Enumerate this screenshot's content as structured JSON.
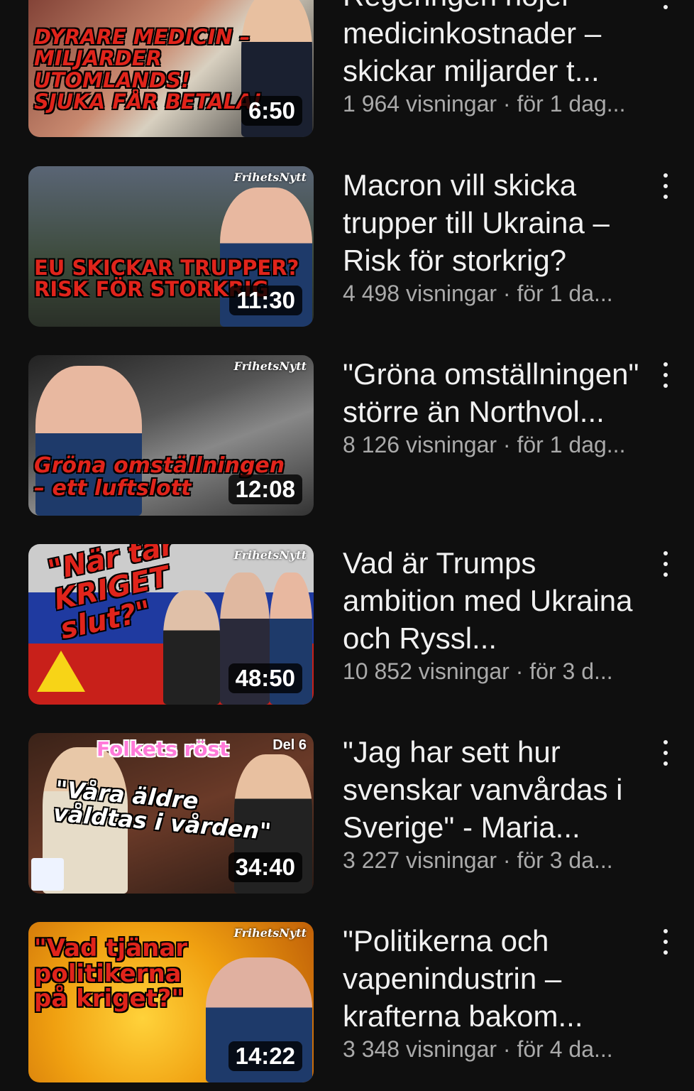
{
  "videos": [
    {
      "title": "Regeringen höjer medicinkostnader – skickar miljarder t...",
      "views": "1 964 visningar",
      "age": "för 1 dag...",
      "duration": "6:50",
      "thumb_caption": "DYRARE MEDICIN –\nMILJARDER\nUTOMLANDS!\nSJUKA FÅR BETALA!",
      "brand": "",
      "colors": {
        "bg": "#5a2a2a",
        "caption": "#e0241b"
      }
    },
    {
      "title": "Macron vill skicka trupper till Ukraina – Risk för storkrig?",
      "views": "4 498 visningar",
      "age": "för 1 da...",
      "duration": "11:30",
      "thumb_caption": "EU SKICKAR TRUPPER?\nRISK FÖR STORKRIG",
      "brand": "FrihetsNytt",
      "colors": {
        "bg": "#4a5566",
        "caption": "#e0241b"
      }
    },
    {
      "title": "\"Gröna omställningen\" större än Northvol...",
      "views": "8 126 visningar",
      "age": "för 1 dag...",
      "duration": "12:08",
      "thumb_caption": "Gröna omställningen\n– ett luftslott",
      "brand": "FrihetsNytt",
      "colors": {
        "bg": "#3a3f48",
        "caption": "#e0241b"
      }
    },
    {
      "title": "Vad är Trumps ambition med Ukraina och Ryssl...",
      "views": "10 852 visningar",
      "age": "för 3 d...",
      "duration": "48:50",
      "thumb_caption": "\"När tar\nKRIGET\nslut?\"",
      "brand": "FrihetsNytt",
      "colors": {
        "bg": "#2a3a8a",
        "caption": "#e0241b"
      }
    },
    {
      "title": "\"Jag har sett hur svenskar vanvårdas i Sverige\" - Maria...",
      "views": "3 227 visningar",
      "age": "för 3 da...",
      "duration": "34:40",
      "thumb_caption": "\"Våra äldre\nvåldtas i vården\"",
      "brand": "Del 6",
      "top_label": "Folkets röst",
      "colors": {
        "bg": "#4a2a20",
        "caption": "#ffffff"
      }
    },
    {
      "title": "\"Politikerna och vapenindustrin – krafterna bakom...",
      "views": "3 348 visningar",
      "age": "för 4 da...",
      "duration": "14:22",
      "thumb_caption": "\"Vad tjänar\npolitikerna\npå kriget?\"",
      "brand": "FrihetsNytt",
      "colors": {
        "bg": "#e8a010",
        "caption": "#e0241b"
      }
    }
  ],
  "separator": " · "
}
